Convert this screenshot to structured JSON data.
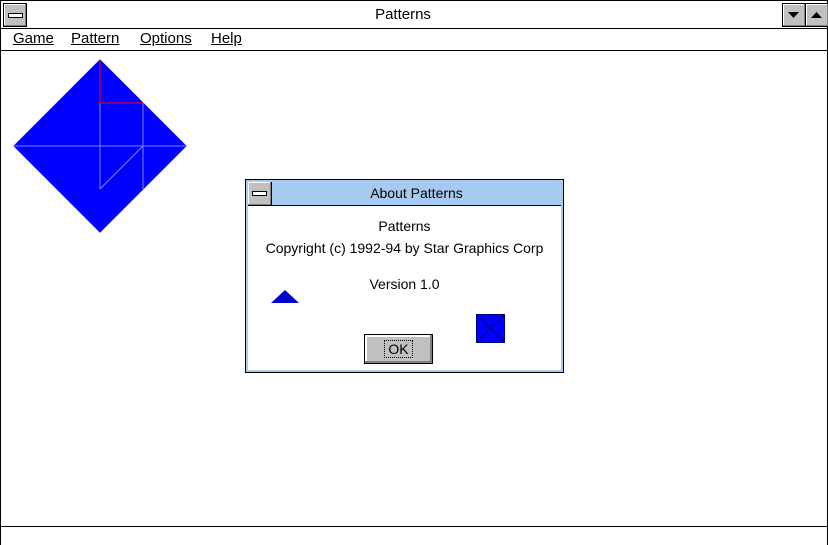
{
  "window": {
    "title": "Patterns"
  },
  "menu": {
    "items": [
      {
        "label": "Game"
      },
      {
        "label": "Pattern"
      },
      {
        "label": "Options"
      },
      {
        "label": "Help"
      }
    ]
  },
  "board": {
    "shape": "diamond",
    "fill_color": "#0000ff",
    "line_color": "#8080ff",
    "highlight_color": "#ff0000"
  },
  "about_dialog": {
    "title": "About Patterns",
    "app_name": "Patterns",
    "copyright": "Copyright (c) 1992-94 by Star Graphics Corp",
    "version": "Version 1.0",
    "ok_label": "OK",
    "icon_color": "#0000cc"
  },
  "colors": {
    "dialog_title_bg": "#a6caf0",
    "button_face": "#c0c0c0"
  }
}
